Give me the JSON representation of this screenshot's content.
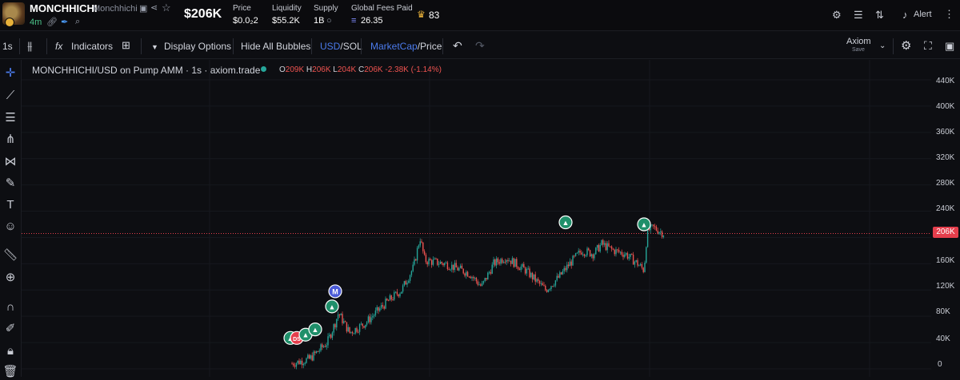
{
  "token": {
    "ticker": "MONCHHICHI",
    "name": "Monchhichi",
    "age": "4m"
  },
  "header": {
    "market_cap": "$206K",
    "stats": [
      {
        "label": "Price",
        "value": "$0.0₂2"
      },
      {
        "label": "Liquidity",
        "value": "$55.2K"
      },
      {
        "label": "Supply",
        "value": "1B"
      },
      {
        "label": "Global Fees Paid",
        "value": "26.35"
      }
    ],
    "crown_count": "83",
    "alert_label": "Alert"
  },
  "toolbar": {
    "interval": "1s",
    "indicators": "Indicators",
    "display_options": "Display Options",
    "hide_bubbles": "Hide All Bubbles",
    "currency_a": "USD",
    "currency_sep": "/",
    "currency_b": "SOL",
    "metric_a": "MarketCap",
    "metric_sep": "/",
    "metric_b": "Price",
    "layout_name": "Axiom",
    "layout_save": "Save"
  },
  "chart_header": {
    "title": "MONCHHICHI/USD on Pump AMM · 1s · axiom.trade",
    "o_label": "O",
    "o_value": "209K",
    "h_label": "H",
    "h_value": "206K",
    "l_label": "L",
    "l_value": "204K",
    "c_label": "C",
    "c_value": "206K",
    "change": "-2.38K (-1.14%)"
  },
  "colors": {
    "up": "#26a69a",
    "down": "#ef5350",
    "price_line": "#e53e4c",
    "background": "#0d0e12",
    "accent_blue": "#4b7bec"
  },
  "y_axis": {
    "ticks": [
      "440K",
      "400K",
      "360K",
      "320K",
      "280K",
      "240K",
      "206K",
      "160K",
      "120K",
      "80K",
      "40K",
      "0"
    ],
    "current": "206K"
  },
  "chart_data": {
    "type": "candlestick",
    "ylim": [
      0,
      460000
    ],
    "last_price": 206000,
    "series": [
      {
        "phase": "early climb",
        "approx_range": [
          5000,
          90000
        ]
      },
      {
        "phase": "rally to peak",
        "approx_range": [
          80000,
          210000
        ]
      },
      {
        "phase": "consolidation",
        "approx_range": [
          120000,
          220000
        ]
      }
    ],
    "markers": [
      {
        "label": "M",
        "price": 118000
      },
      {
        "label": "DS",
        "price": 47000
      }
    ]
  }
}
